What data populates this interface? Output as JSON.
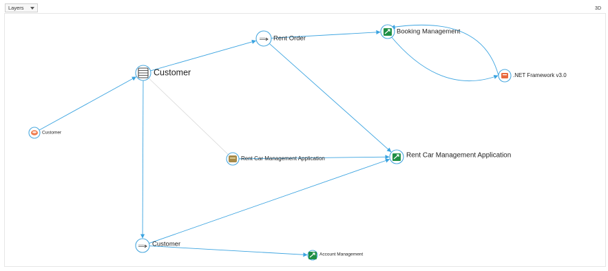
{
  "toolbar": {
    "layers_label": "Layers",
    "view_mode_label": "3D"
  },
  "graph": {
    "nodes": [
      {
        "id": "customer_table",
        "label": "Customer",
        "icon": "table-icon"
      },
      {
        "id": "rent_order",
        "label": "Rent Order",
        "icon": "process-arrow-icon"
      },
      {
        "id": "booking_mgmt",
        "label": "Booking Management",
        "icon": "application-component-icon"
      },
      {
        "id": "net_framework",
        "label": ".NET Framework v3.0",
        "icon": "system-software-icon"
      },
      {
        "id": "customer_actor",
        "label": "Customer",
        "icon": "actor-role-icon"
      },
      {
        "id": "rent_car_app_svc",
        "label": "Rent Car Management Application",
        "icon": "application-service-icon"
      },
      {
        "id": "rent_car_app",
        "label": "Rent Car Management Application",
        "icon": "application-component-icon"
      },
      {
        "id": "customer_process",
        "label": "Customer",
        "icon": "process-arrow-icon"
      },
      {
        "id": "account_mgmt",
        "label": "Account Management",
        "icon": "application-component-icon"
      }
    ],
    "edges": [
      {
        "from": "customer_actor",
        "to": "customer_table"
      },
      {
        "from": "customer_table",
        "to": "rent_order"
      },
      {
        "from": "rent_order",
        "to": "booking_mgmt"
      },
      {
        "from": "booking_mgmt",
        "to": "net_framework"
      },
      {
        "from": "net_framework",
        "to": "booking_mgmt"
      },
      {
        "from": "rent_order",
        "to": "rent_car_app"
      },
      {
        "from": "customer_table",
        "to": "rent_car_app_svc"
      },
      {
        "from": "rent_car_app_svc",
        "to": "rent_car_app"
      },
      {
        "from": "customer_table",
        "to": "customer_process"
      },
      {
        "from": "customer_process",
        "to": "rent_car_app"
      },
      {
        "from": "customer_process",
        "to": "account_mgmt"
      }
    ],
    "colors": {
      "edge": "#3aa3e0",
      "faint_edge": "#d9d9d9",
      "node_ring": "#4aa8de",
      "app_green": "#1f8f45",
      "net_orange": "#e8683d",
      "actor_orange": "#ef7a4b",
      "service_olive": "#a68a4a"
    }
  }
}
